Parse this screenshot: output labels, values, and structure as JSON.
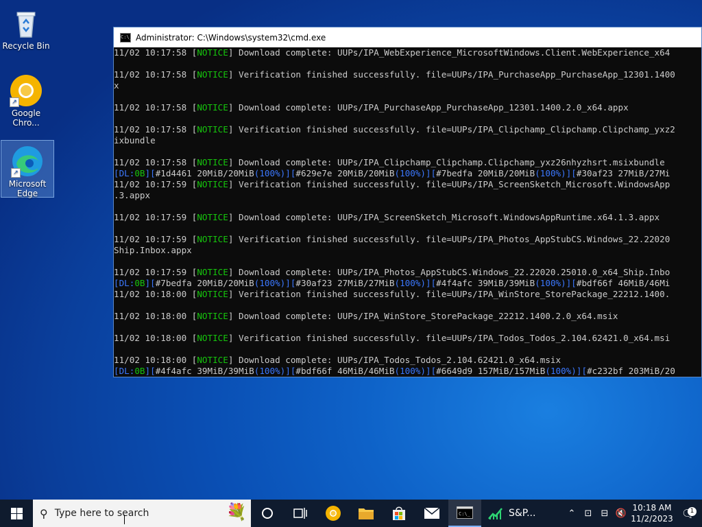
{
  "desktop": {
    "icons": [
      {
        "label": "Recycle Bin"
      },
      {
        "label": "Google Chro..."
      },
      {
        "label": "Microsoft Edge"
      }
    ]
  },
  "cmd": {
    "title": "Administrator: C:\\Windows\\system32\\cmd.exe",
    "icon_text": "C:\\_",
    "lines": [
      [
        {
          "t": "11/02 10:17:58 ["
        },
        {
          "t": "NOTICE",
          "c": "g"
        },
        {
          "t": "] Download complete: UUPs/IPA_WebExperience_MicrosoftWindows.Client.WebExperience_x64"
        }
      ],
      [],
      [
        {
          "t": "11/02 10:17:58 ["
        },
        {
          "t": "NOTICE",
          "c": "g"
        },
        {
          "t": "] Verification finished successfully. file=UUPs/IPA_PurchaseApp_PurchaseApp_12301.1400"
        }
      ],
      [
        {
          "t": "x"
        }
      ],
      [],
      [
        {
          "t": "11/02 10:17:58 ["
        },
        {
          "t": "NOTICE",
          "c": "g"
        },
        {
          "t": "] Download complete: UUPs/IPA_PurchaseApp_PurchaseApp_12301.1400.2.0_x64.appx"
        }
      ],
      [],
      [
        {
          "t": "11/02 10:17:58 ["
        },
        {
          "t": "NOTICE",
          "c": "g"
        },
        {
          "t": "] Verification finished successfully. file=UUPs/IPA_Clipchamp_Clipchamp.Clipchamp_yxz2"
        }
      ],
      [
        {
          "t": "ixbundle"
        }
      ],
      [],
      [
        {
          "t": "11/02 10:17:58 ["
        },
        {
          "t": "NOTICE",
          "c": "g"
        },
        {
          "t": "] Download complete: UUPs/IPA_Clipchamp_Clipchamp.Clipchamp_yxz26nhyzhsrt.msixbundle"
        }
      ],
      [
        {
          "t": "[",
          "c": "b"
        },
        {
          "t": "DL:",
          "c": "b"
        },
        {
          "t": "0B",
          "c": "g"
        },
        {
          "t": "][",
          "c": "b"
        },
        {
          "t": "#1d4461 20MiB/20MiB"
        },
        {
          "t": "(100%)",
          "c": "b"
        },
        {
          "t": "][",
          "c": "b"
        },
        {
          "t": "#629e7e 20MiB/20MiB"
        },
        {
          "t": "(100%)",
          "c": "b"
        },
        {
          "t": "][",
          "c": "b"
        },
        {
          "t": "#7bedfa 20MiB/20MiB"
        },
        {
          "t": "(100%)",
          "c": "b"
        },
        {
          "t": "][",
          "c": "b"
        },
        {
          "t": "#30af23 27MiB/27Mi"
        }
      ],
      [
        {
          "t": "11/02 10:17:59 ["
        },
        {
          "t": "NOTICE",
          "c": "g"
        },
        {
          "t": "] Verification finished successfully. file=UUPs/IPA_ScreenSketch_Microsoft.WindowsApp"
        }
      ],
      [
        {
          "t": ".3.appx"
        }
      ],
      [],
      [
        {
          "t": "11/02 10:17:59 ["
        },
        {
          "t": "NOTICE",
          "c": "g"
        },
        {
          "t": "] Download complete: UUPs/IPA_ScreenSketch_Microsoft.WindowsAppRuntime.x64.1.3.appx"
        }
      ],
      [],
      [
        {
          "t": "11/02 10:17:59 ["
        },
        {
          "t": "NOTICE",
          "c": "g"
        },
        {
          "t": "] Verification finished successfully. file=UUPs/IPA_Photos_AppStubCS.Windows_22.22020"
        }
      ],
      [
        {
          "t": "Ship.Inbox.appx"
        }
      ],
      [],
      [
        {
          "t": "11/02 10:17:59 ["
        },
        {
          "t": "NOTICE",
          "c": "g"
        },
        {
          "t": "] Download complete: UUPs/IPA_Photos_AppStubCS.Windows_22.22020.25010.0_x64_Ship.Inbo"
        }
      ],
      [
        {
          "t": "[",
          "c": "b"
        },
        {
          "t": "DL:",
          "c": "b"
        },
        {
          "t": "0B",
          "c": "g"
        },
        {
          "t": "][",
          "c": "b"
        },
        {
          "t": "#7bedfa 20MiB/20MiB"
        },
        {
          "t": "(100%)",
          "c": "b"
        },
        {
          "t": "][",
          "c": "b"
        },
        {
          "t": "#30af23 27MiB/27MiB"
        },
        {
          "t": "(100%)",
          "c": "b"
        },
        {
          "t": "][",
          "c": "b"
        },
        {
          "t": "#4f4afc 39MiB/39MiB"
        },
        {
          "t": "(100%)",
          "c": "b"
        },
        {
          "t": "][",
          "c": "b"
        },
        {
          "t": "#bdf66f 46MiB/46Mi"
        }
      ],
      [
        {
          "t": "11/02 10:18:00 ["
        },
        {
          "t": "NOTICE",
          "c": "g"
        },
        {
          "t": "] Verification finished successfully. file=UUPs/IPA_WinStore_StorePackage_22212.1400."
        }
      ],
      [],
      [
        {
          "t": "11/02 10:18:00 ["
        },
        {
          "t": "NOTICE",
          "c": "g"
        },
        {
          "t": "] Download complete: UUPs/IPA_WinStore_StorePackage_22212.1400.2.0_x64.msix"
        }
      ],
      [],
      [
        {
          "t": "11/02 10:18:00 ["
        },
        {
          "t": "NOTICE",
          "c": "g"
        },
        {
          "t": "] Verification finished successfully. file=UUPs/IPA_Todos_Todos_2.104.62421.0_x64.msi"
        }
      ],
      [],
      [
        {
          "t": "11/02 10:18:00 ["
        },
        {
          "t": "NOTICE",
          "c": "g"
        },
        {
          "t": "] Download complete: UUPs/IPA_Todos_Todos_2.104.62421.0_x64.msix"
        }
      ],
      [
        {
          "t": "[",
          "c": "b"
        },
        {
          "t": "DL:",
          "c": "b"
        },
        {
          "t": "0B",
          "c": "g"
        },
        {
          "t": "][",
          "c": "b"
        },
        {
          "t": "#4f4afc 39MiB/39MiB"
        },
        {
          "t": "(100%)",
          "c": "b"
        },
        {
          "t": "][",
          "c": "b"
        },
        {
          "t": "#bdf66f 46MiB/46MiB"
        },
        {
          "t": "(100%)",
          "c": "b"
        },
        {
          "t": "][",
          "c": "b"
        },
        {
          "t": "#6649d9 157MiB/157MiB"
        },
        {
          "t": "(100%)",
          "c": "b"
        },
        {
          "t": "][",
          "c": "b"
        },
        {
          "t": "#c232bf 203MiB/20"
        }
      ]
    ]
  },
  "taskbar": {
    "search_placeholder": "Type here to search",
    "sp_label": "S&P...",
    "time": "10:18 AM",
    "date": "11/2/2023",
    "notification_count": "1"
  },
  "colors": {
    "notice_green": "#16c60c",
    "progress_blue": "#3b78ff",
    "console_text": "#cccccc",
    "console_bg": "#0c0c0c"
  }
}
